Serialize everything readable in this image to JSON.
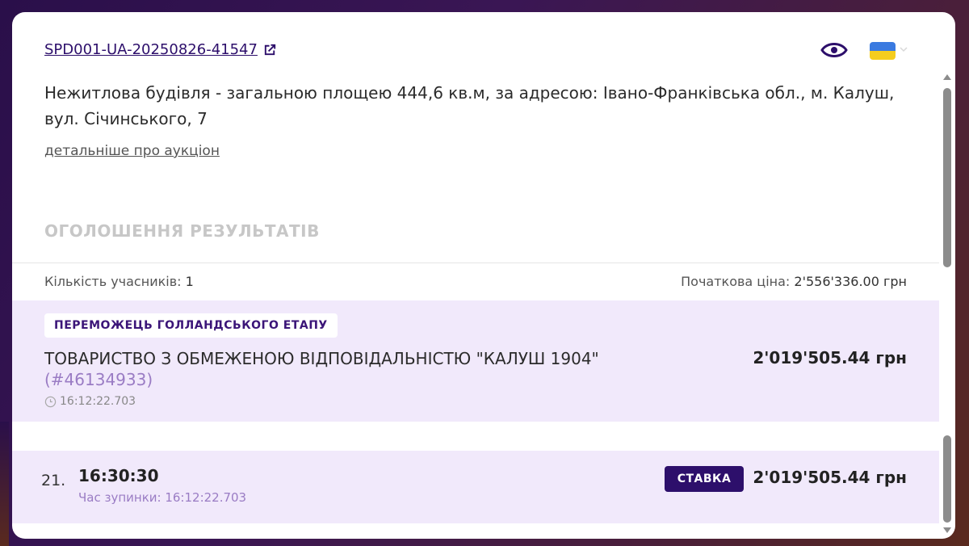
{
  "header": {
    "auction_id": "SPD001-UA-20250826-41547",
    "description": "Нежитлова будівля - загальною площею 444,6 кв.м, за адресою: Івано-Франківська обл., м. Калуш, вул. Січинського, 7",
    "details_link": "детальніше про аукціон",
    "icons": {
      "external": "external-link-icon",
      "watch": "eye-icon",
      "language": "ukraine-flag-icon",
      "dropdown": "chevron-down-icon"
    },
    "colors": {
      "brand": "#2d0f6b",
      "flag_blue": "#3a7ae0",
      "flag_yellow": "#f5cd1e"
    }
  },
  "results": {
    "title": "ОГОЛОШЕННЯ РЕЗУЛЬТАТІВ",
    "participants_label": "Кількість учасників:",
    "participants_value": "1",
    "start_price_label": "Початкова ціна:",
    "start_price_value": "2'556'336.00 грн"
  },
  "winner": {
    "badge": "ПЕРЕМОЖЕЦЬ ГОЛЛАНДСЬКОГО ЕТАПУ",
    "name": "ТОВАРИСТВО З ОБМЕЖЕНОЮ ВІДПОВІДАЛЬНІСТЮ \"КАЛУШ 1904\"",
    "id": "(#46134933)",
    "time": "16:12:22.703",
    "amount": "2'019'505.44 грн",
    "background": "#f1e9fb"
  },
  "bid": {
    "index": "21.",
    "time": "16:30:30",
    "stop_label": "Час зупинки: 16:12:22.703",
    "badge": "СТАВКА",
    "amount": "2'019'505.44 грн"
  }
}
